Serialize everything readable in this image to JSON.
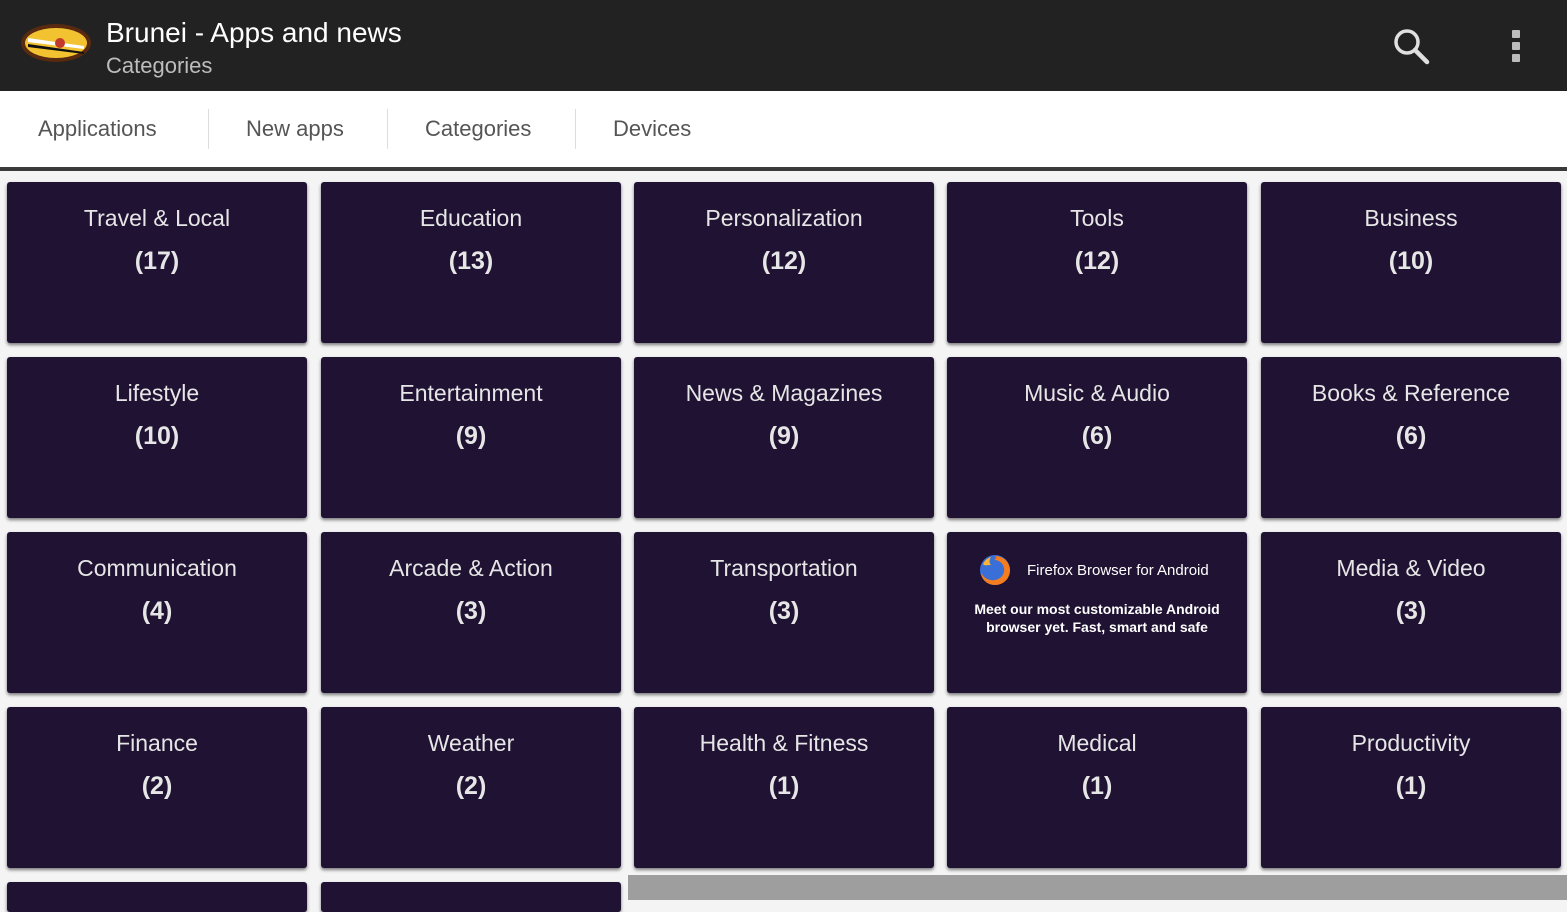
{
  "appbar": {
    "title": "Brunei - Apps and news",
    "subtitle": "Categories",
    "logo_icon": "brunei-emblem-icon",
    "search_icon": "search-icon",
    "menu_icon": "overflow-menu-icon"
  },
  "tabs": [
    {
      "label": "Applications"
    },
    {
      "label": "New apps"
    },
    {
      "label": "Categories"
    },
    {
      "label": "Devices"
    }
  ],
  "tiles": [
    {
      "name": "Travel & Local",
      "count": "(17)"
    },
    {
      "name": "Education",
      "count": "(13)"
    },
    {
      "name": "Personalization",
      "count": "(12)"
    },
    {
      "name": "Tools",
      "count": "(12)"
    },
    {
      "name": "Business",
      "count": "(10)"
    },
    {
      "name": "Lifestyle",
      "count": "(10)"
    },
    {
      "name": "Entertainment",
      "count": "(9)"
    },
    {
      "name": "News & Magazines",
      "count": "(9)"
    },
    {
      "name": "Music & Audio",
      "count": "(6)"
    },
    {
      "name": "Books & Reference",
      "count": "(6)"
    },
    {
      "name": "Communication",
      "count": "(4)"
    },
    {
      "name": "Arcade & Action",
      "count": "(3)"
    },
    {
      "name": "Transportation",
      "count": "(3)"
    },
    {
      "name": "",
      "count": ""
    },
    {
      "name": "Media & Video",
      "count": "(3)"
    },
    {
      "name": "Finance",
      "count": "(2)"
    },
    {
      "name": "Weather",
      "count": "(2)"
    },
    {
      "name": "Health & Fitness",
      "count": "(1)"
    },
    {
      "name": "Medical",
      "count": "(1)"
    },
    {
      "name": "Productivity",
      "count": "(1)"
    }
  ],
  "ad": {
    "title": "Firefox Browser for Android",
    "description": "Meet our most customizable Android browser yet. Fast, smart and safe",
    "icon": "firefox-icon"
  },
  "colors": {
    "appbar": "#222222",
    "tile": "#1f1232",
    "background": "#f4f4f4"
  }
}
